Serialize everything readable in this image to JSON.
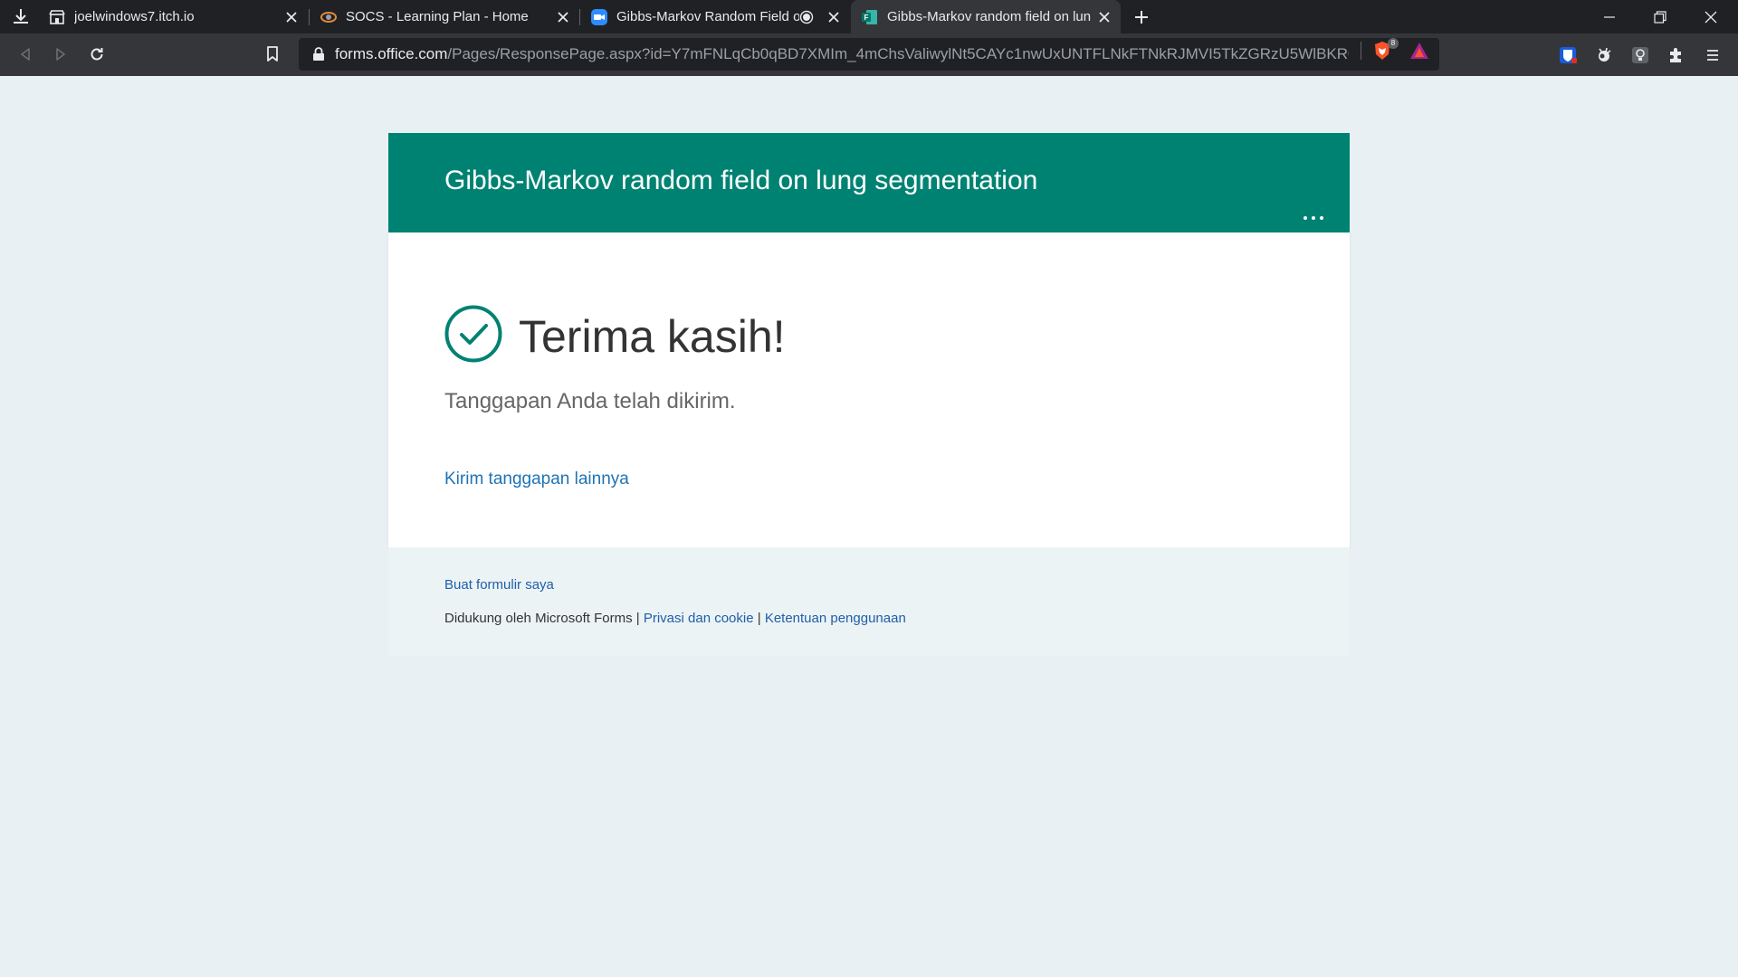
{
  "browser": {
    "tabs": [
      {
        "title": "joelwindows7.itch.io",
        "favicon": "itch-store-icon",
        "active": false
      },
      {
        "title": "SOCS - Learning Plan - Home",
        "favicon": "socs-icon",
        "active": false
      },
      {
        "title": "Gibbs-Markov Random Field o",
        "favicon": "zoom-video-icon",
        "active": false,
        "recording": true
      },
      {
        "title": "Gibbs-Markov random field on lun",
        "favicon": "forms-icon",
        "active": true
      }
    ],
    "url_host": "forms.office.com",
    "url_path": "/Pages/ResponsePage.aspx?id=Y7mFNLqCb0qBD7XMIm_4mChsValiwylNt5CAYc1nwUxUNTFLNkFTNkRJMVI5TkZGRzU5WlBKR0...",
    "shield_count": "8",
    "colors": {
      "tabstrip": "#202124",
      "toolbar": "#35363a",
      "omnibox": "#202124"
    }
  },
  "form": {
    "title": "Gibbs-Markov random field on lung segmentation",
    "thanks": "Terima kasih!",
    "submitted_message": "Tanggapan Anda telah dikirim.",
    "submit_another": "Kirim tanggapan lainnya",
    "colors": {
      "header": "#008272",
      "link": "#1e73b5",
      "check": "#008272"
    }
  },
  "footer": {
    "create_form": "Buat formulir saya",
    "powered_by": "Didukung oleh Microsoft Forms",
    "separator": "|",
    "privacy": "Privasi dan cookie",
    "terms": "Ketentuan penggunaan"
  }
}
